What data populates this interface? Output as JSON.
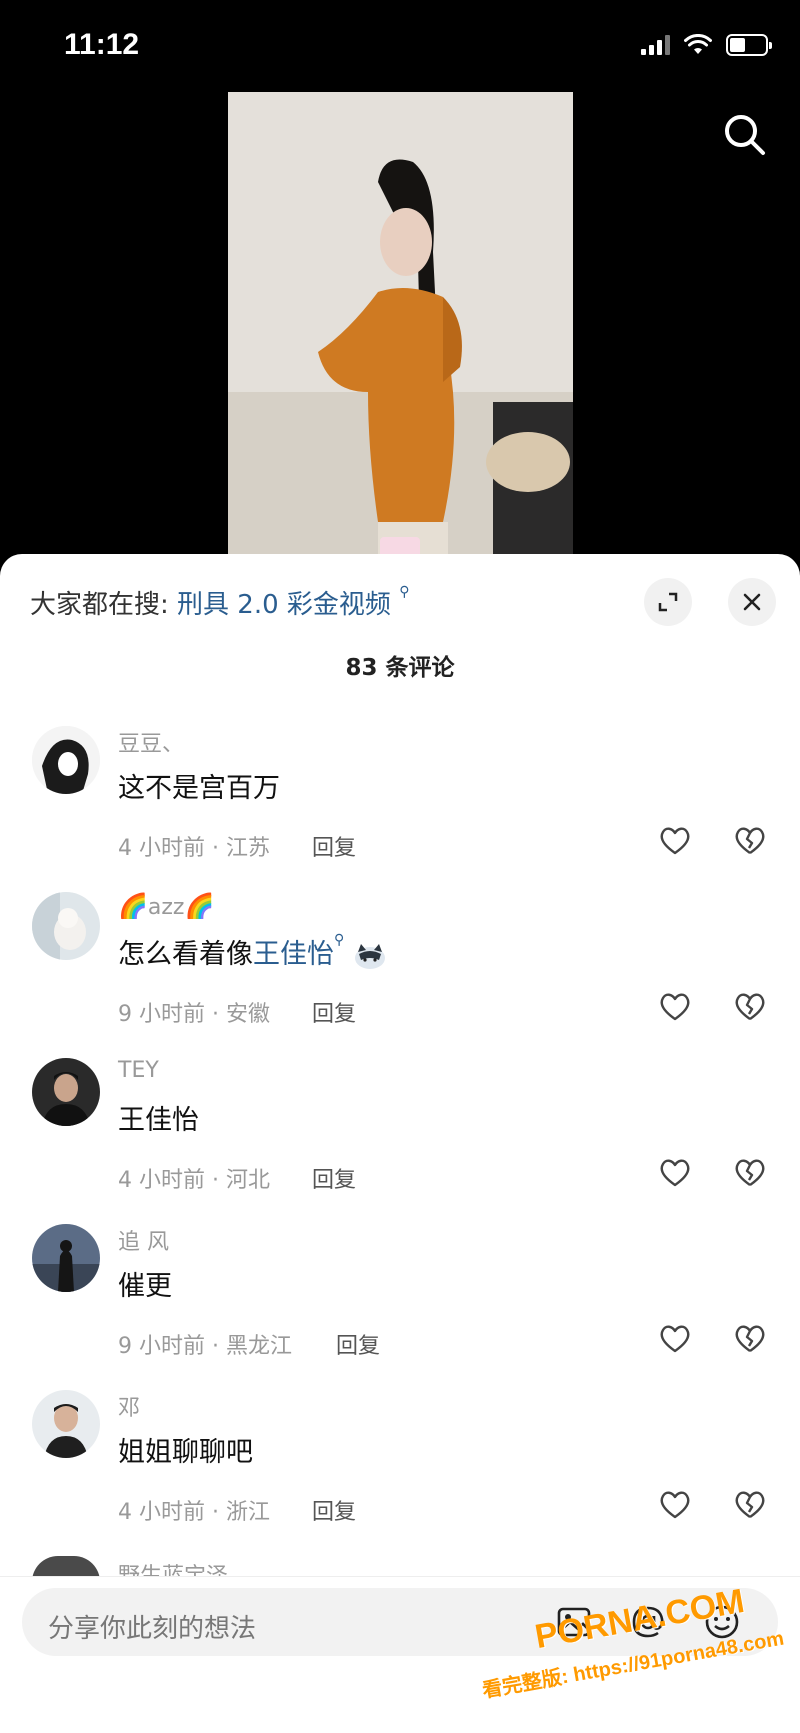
{
  "status_bar": {
    "time": "11:12"
  },
  "sheet": {
    "trending_prefix": "大家都在搜:",
    "trending_query": "刑具 2.0 彩金视频",
    "comment_count": "83 条评论"
  },
  "comments": [
    {
      "username": "豆豆、",
      "text": "这不是宫百万",
      "meta": "4 小时前 · 江苏",
      "reply": "回复"
    },
    {
      "username": "azz",
      "text_prefix": "怎么看着像",
      "text_link": "王佳怡",
      "meta": "9 小时前 · 安徽",
      "reply": "回复"
    },
    {
      "username": "TEY",
      "text": "王佳怡",
      "meta": "4 小时前 · 河北",
      "reply": "回复"
    },
    {
      "username": "追 风",
      "text": "催更",
      "meta": "9 小时前 · 黑龙江",
      "reply": "回复"
    },
    {
      "username": "邓",
      "text": "姐姐聊聊吧",
      "meta": "4 小时前 · 浙江",
      "reply": "回复"
    }
  ],
  "partial_username": "野生蓝宝泽",
  "input": {
    "placeholder": "分享你此刻的想法"
  },
  "watermark": {
    "brand": "PORNA.COM",
    "url": "看完整版: https://91porna48.com"
  },
  "colors": {
    "link": "#2a5d8f",
    "sheet_bg": "#ffffff",
    "input_bg": "#f2f2f2",
    "watermark": "#ff9a00"
  }
}
